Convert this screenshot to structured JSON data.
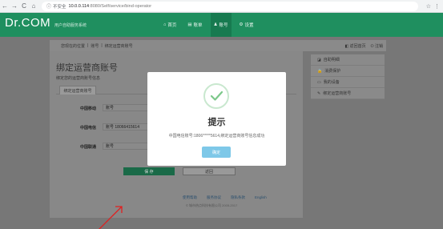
{
  "browser": {
    "back": "←",
    "forward": "→",
    "reload": "C",
    "home": "⌂",
    "security_label": "不安全",
    "host": "10.0.0.114",
    "path": ":8080/Self/service/bind-operator"
  },
  "header": {
    "logo": "Dr.COM",
    "subtitle": "用户自助服务系统",
    "nav": [
      {
        "icon": "home-icon",
        "label": "首页"
      },
      {
        "icon": "bill-icon",
        "label": "账单"
      },
      {
        "icon": "account-icon",
        "label": "账号"
      },
      {
        "icon": "settings-icon",
        "label": "设置"
      }
    ]
  },
  "breadcrumb": {
    "items": [
      "您现在的位置",
      "账号",
      "绑定运营商账号"
    ],
    "right": [
      "返回首页",
      "注销"
    ]
  },
  "main": {
    "title": "绑定运营商账号",
    "subtitle": "绑定您的运营商账号信息",
    "tab": "绑定运营商账号",
    "rows": [
      {
        "label": "中国移动",
        "value": "账号"
      },
      {
        "label": "中国电信",
        "value": "账号  18066415614"
      },
      {
        "label": "中国联通",
        "value": "账号"
      }
    ],
    "save": "保 存",
    "back": "返回"
  },
  "sidebar": {
    "items": [
      "自助明细",
      "消费保护",
      "我的设备",
      "绑定运营商账号"
    ]
  },
  "footer": {
    "links": [
      "使用帮助",
      "服务协议",
      "隐私条款",
      "English"
    ],
    "copyright": "© 城市热点科技有限公司 2005-2017"
  },
  "modal": {
    "title": "提示",
    "message": "中国电信账号:1806*****5614,绑定运营商账号信息成功",
    "ok": "确定"
  },
  "colors": {
    "brand": "#1f8f5f",
    "modal_button": "#7ec8e8",
    "annotation_arrow": "#e02020"
  }
}
